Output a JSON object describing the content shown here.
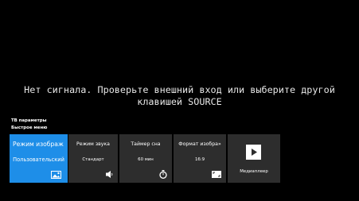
{
  "message": {
    "line1": "Нет сигнала. Проверьте внешний вход или выберите другой",
    "line2": "клавишей SOURCE"
  },
  "breadcrumb": {
    "section": "ТВ параметры",
    "menu": "Быстрое меню"
  },
  "tiles": [
    {
      "title": "Режим изображ",
      "value": "Пользовательский",
      "icon": "picture-icon"
    },
    {
      "title": "Режим звука",
      "value": "Стандарт",
      "icon": "speaker-icon"
    },
    {
      "title": "Таймер сна",
      "value": "60 мин",
      "icon": "timer-icon"
    },
    {
      "title": "Формат изобра»",
      "value": "16:9",
      "icon": "aspect-ratio-icon"
    },
    {
      "title": "Медиаплеер",
      "icon": "play-icon"
    }
  ],
  "colors": {
    "background": "#000000",
    "tile": "#2d2d2d",
    "tile_active": "#1e8ee8",
    "text": "#ffffff"
  }
}
